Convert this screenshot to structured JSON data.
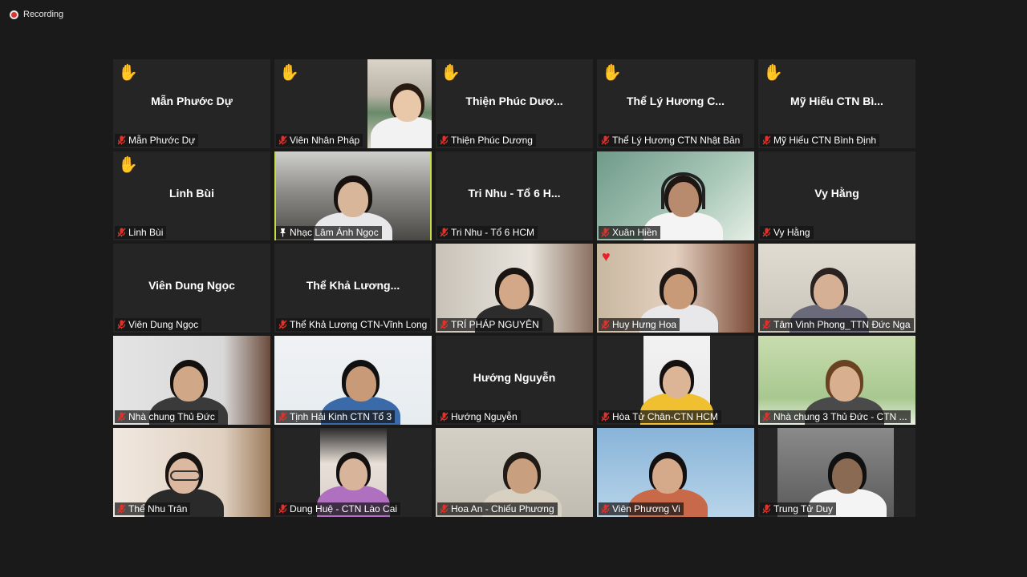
{
  "recording": {
    "label": "Recording"
  },
  "icons": {
    "raised_hand": "raised-hand-icon",
    "muted_mic": "muted-mic-icon",
    "pin": "pin-icon",
    "heart": "heart-reaction-icon",
    "recording": "recording-icon"
  },
  "colors": {
    "active_speaker_border": "#c7dc45",
    "tile_bg": "#252525",
    "muted_mic": "#e0322c"
  },
  "participants": [
    {
      "label": "Mẫn Phước Dự",
      "center": "Mẫn Phước Dự"
    },
    {
      "label": "Viên Nhân Pháp"
    },
    {
      "label": "Thiện Phúc Dương",
      "center": "Thiện Phúc Dươ..."
    },
    {
      "label": "Thể Lý Hương CTN Nhật Bản",
      "center": "Thể Lý Hương C..."
    },
    {
      "label": "Mỹ Hiếu CTN Bình Định",
      "center": "Mỹ Hiếu CTN Bì..."
    },
    {
      "label": "Linh Bùi",
      "center": "Linh Bùi"
    },
    {
      "label": "Nhạc Lâm Ánh Ngọc"
    },
    {
      "label": "Tri Nhu - Tổ 6 HCM",
      "center": "Tri Nhu - Tổ 6 H..."
    },
    {
      "label": "Xuân Hiền"
    },
    {
      "label": "Vy Hằng",
      "center": "Vy Hằng"
    },
    {
      "label": "Viên Dung Ngọc",
      "center": "Viên Dung Ngọc"
    },
    {
      "label": "Thể Khả Lương CTN-Vĩnh Long",
      "center": "Thể Khả Lương..."
    },
    {
      "label": "TRÍ PHÁP NGUYÊN"
    },
    {
      "label": "Huy Hưng Hoa"
    },
    {
      "label": "Tâm Vinh Phong_TTN Đức Nga"
    },
    {
      "label": "Nhà chung Thủ Đức"
    },
    {
      "label": "Tịnh Hải Kinh CTN Tổ 3"
    },
    {
      "label": "Hướng Nguyễn",
      "center": "Hướng Nguyễn"
    },
    {
      "label": "Hòa Tử Chân-CTN HCM"
    },
    {
      "label": "Nhà chung 3 Thủ Đức - CTN ..."
    },
    {
      "label": "Thể Nhu Trân"
    },
    {
      "label": "Dung Huệ - CTN Lào Cai"
    },
    {
      "label": "Hoa An - Chiếu Phương"
    },
    {
      "label": "Viên Phương Vi"
    },
    {
      "label": "Trung Tử Duy"
    }
  ]
}
